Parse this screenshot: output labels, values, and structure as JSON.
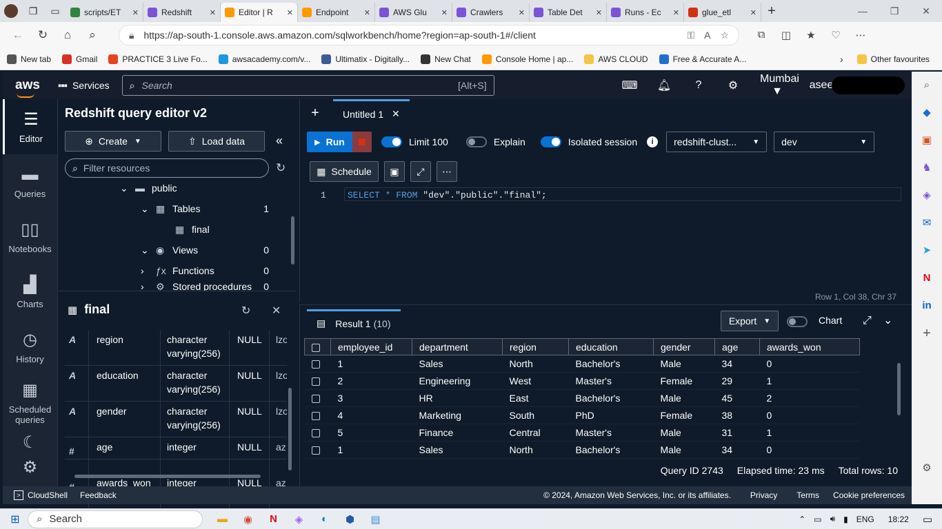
{
  "browser": {
    "tabs": [
      {
        "label": "",
        "color": "#ffffff"
      },
      {
        "label": "scripts/ET",
        "color": "#2e8540"
      },
      {
        "label": "Redshift",
        "color": "#7b54d6"
      },
      {
        "label": "Editor | R",
        "color": "#ff9900",
        "active": true
      },
      {
        "label": "Endpoint",
        "color": "#ff9900"
      },
      {
        "label": "AWS Glu",
        "color": "#7b54d6"
      },
      {
        "label": "Crawlers",
        "color": "#7b54d6"
      },
      {
        "label": "Table Det",
        "color": "#7b54d6"
      },
      {
        "label": "Runs - Ec",
        "color": "#7b54d6"
      },
      {
        "label": "glue_etl",
        "color": "#d13212"
      }
    ],
    "url": "https://ap-south-1.console.aws.amazon.com/sqlworkbench/home?region=ap-south-1#/client",
    "bookmarks": [
      {
        "label": "New tab",
        "color": "#555555"
      },
      {
        "label": "Gmail",
        "color": "#d93025"
      },
      {
        "label": "PRACTICE 3 Live Fo...",
        "color": "#e8441b"
      },
      {
        "label": "awsacademy.com/v...",
        "color": "#1a9ae0"
      },
      {
        "label": "Ultimatix - Digitally...",
        "color": "#3d5a99"
      },
      {
        "label": "New Chat",
        "color": "#333333"
      },
      {
        "label": "Console Home | ap...",
        "color": "#ff9900"
      },
      {
        "label": "AWS CLOUD",
        "color": "#f4c542"
      },
      {
        "label": "Free & Accurate A...",
        "color": "#1f6fd1"
      }
    ],
    "other_favourites": "Other favourites"
  },
  "aws_header": {
    "logo": "aws",
    "services": "Services",
    "search_placeholder": "Search",
    "search_shortcut": "[Alt+S]",
    "region": "Mumbai ▼",
    "user": "asee"
  },
  "left_nav": [
    {
      "label": "Editor",
      "icon": "editor-icon",
      "glyph": "☰",
      "active": true
    },
    {
      "label": "Queries",
      "icon": "folder-icon",
      "glyph": "▬"
    },
    {
      "label": "Notebooks",
      "icon": "book-icon",
      "glyph": "▯▯"
    },
    {
      "label": "Charts",
      "icon": "charts-icon",
      "glyph": "▟"
    },
    {
      "label": "History",
      "icon": "clock-icon",
      "glyph": "◷"
    },
    {
      "label": "Scheduled queries",
      "icon": "calendar-icon",
      "glyph": "▦"
    }
  ],
  "tree": {
    "title": "Redshift query editor v2",
    "create_label": "Create",
    "load_label": "Load data",
    "filter_placeholder": "Filter resources",
    "nodes": [
      {
        "label": "public",
        "count": ""
      },
      {
        "label": "Tables",
        "count": "1"
      },
      {
        "label": "final",
        "count": ""
      },
      {
        "label": "Views",
        "count": "0"
      },
      {
        "label": "Functions",
        "count": "0"
      },
      {
        "label": "Stored procedures",
        "count": "0"
      }
    ]
  },
  "column_panel": {
    "title": "final",
    "rows": [
      {
        "type": "A",
        "name": "region",
        "dtype1": "character",
        "dtype2": "varying(256)",
        "nullable": "NULL",
        "enc": "lzo"
      },
      {
        "type": "A",
        "name": "education",
        "dtype1": "character",
        "dtype2": "varying(256)",
        "nullable": "NULL",
        "enc": "lzo"
      },
      {
        "type": "A",
        "name": "gender",
        "dtype1": "character",
        "dtype2": "varying(256)",
        "nullable": "NULL",
        "enc": "lzo"
      },
      {
        "type": "#",
        "name": "age",
        "dtype1": "integer",
        "dtype2": "",
        "nullable": "NULL",
        "enc": "az"
      },
      {
        "type": "#",
        "name": "awards_won",
        "dtype1": "integer",
        "dtype2": "",
        "nullable": "NULL",
        "enc": "az"
      }
    ]
  },
  "editor": {
    "tab_title": "Untitled 1",
    "run_label": "Run",
    "limit_label": "Limit 100",
    "explain_label": "Explain",
    "isolated_label": "Isolated session",
    "cluster": "redshift-clust...",
    "database": "dev",
    "schedule_label": "Schedule",
    "line_number": "1",
    "sql_keyword1": "SELECT",
    "sql_star": "*",
    "sql_keyword2": "FROM",
    "sql_target": "\"dev\".\"public\".\"final\";",
    "status": "Row 1,  Col 38,  Chr 37"
  },
  "results": {
    "tab_label": "Result 1",
    "tab_count": "(10)",
    "export_label": "Export",
    "chart_label": "Chart",
    "columns": [
      "employee_id",
      "department",
      "region",
      "education",
      "gender",
      "age",
      "awards_won"
    ],
    "rows": [
      [
        "1",
        "Sales",
        "North",
        "Bachelor's",
        "Male",
        "34",
        "0"
      ],
      [
        "2",
        "Engineering",
        "West",
        "Master's",
        "Female",
        "29",
        "1"
      ],
      [
        "3",
        "HR",
        "East",
        "Bachelor's",
        "Male",
        "45",
        "2"
      ],
      [
        "4",
        "Marketing",
        "South",
        "PhD",
        "Female",
        "38",
        "0"
      ],
      [
        "5",
        "Finance",
        "Central",
        "Master's",
        "Male",
        "31",
        "1"
      ],
      [
        "1",
        "Sales",
        "North",
        "Bachelor's",
        "Male",
        "34",
        "0"
      ]
    ],
    "query_id": "Query ID 2743",
    "elapsed": "Elapsed time: 23 ms",
    "total_rows": "Total rows: 10"
  },
  "aws_footer": {
    "cloudshell": "CloudShell",
    "feedback": "Feedback",
    "copyright": "© 2024, Amazon Web Services, Inc. or its affiliates.",
    "privacy": "Privacy",
    "terms": "Terms",
    "cookies": "Cookie preferences"
  },
  "taskbar": {
    "search_label": "Search",
    "language": "ENG",
    "time": "18:22"
  }
}
